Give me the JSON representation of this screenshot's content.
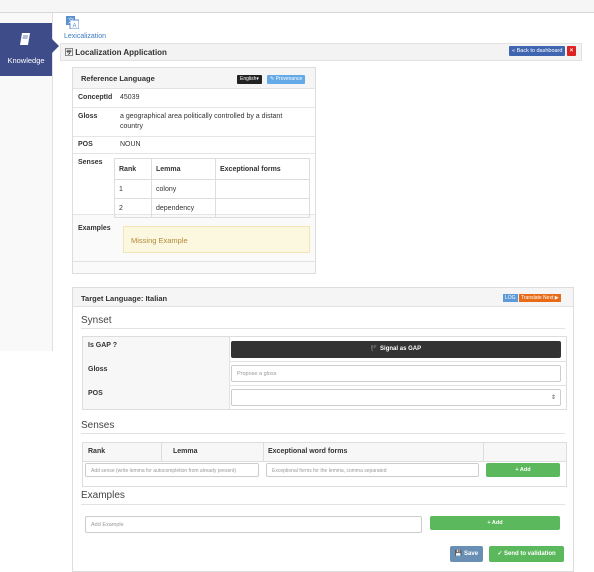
{
  "sidebar": {
    "item_label": "Knowledge",
    "item_icon": "book-icon"
  },
  "breadcrumb": {
    "label": "Lexicalization",
    "icon": "translate-icon"
  },
  "title": {
    "label": "Localization Application",
    "back_label": "« Back to dashboard",
    "close_label": "×"
  },
  "reference": {
    "header": "Reference Language",
    "lang_button": "English▾",
    "provenance_button": "✎ Provenance",
    "concept_key": "ConceptId",
    "concept_value": "45039",
    "gloss_key": "Gloss",
    "gloss_line1": "a geographical area politically controlled by a distant",
    "gloss_line2": "country",
    "pos_key": "POS",
    "pos_value": "NOUN",
    "senses_key": "Senses",
    "senses_headers": [
      "Rank",
      "Lemma",
      "Exceptional forms"
    ],
    "senses_rows": [
      {
        "rank": "1",
        "lemma": "colony",
        "forms": ""
      },
      {
        "rank": "2",
        "lemma": "dependency",
        "forms": ""
      }
    ],
    "examples_key": "Examples",
    "missing_example": "Missing Example"
  },
  "target": {
    "header": "Target Language: Italian",
    "log_button": "LOG",
    "translate_next": "Translate Next ▶",
    "synset_title": "Synset",
    "isgap_label": "Is GAP ?",
    "gap_button": "🏴 Signal as GAP",
    "gloss_label": "Gloss",
    "gloss_placeholder": "Propose a gloss",
    "pos_label": "POS",
    "pos_value": "",
    "senses_title": "Senses",
    "senses_headers": [
      "Rank",
      "Lemma",
      "Exceptional word forms"
    ],
    "sense_placeholder": "Add sense (write lemma for autocompletion from already present)",
    "forms_placeholder": "Exceptional forms for the lemma, comma separated",
    "add_label": "+ Add",
    "examples_title": "Examples",
    "example_placeholder": "Add Example",
    "add_example_label": "+ Add",
    "save_label": "💾 Save",
    "send_label": "✓ Send to validation"
  }
}
